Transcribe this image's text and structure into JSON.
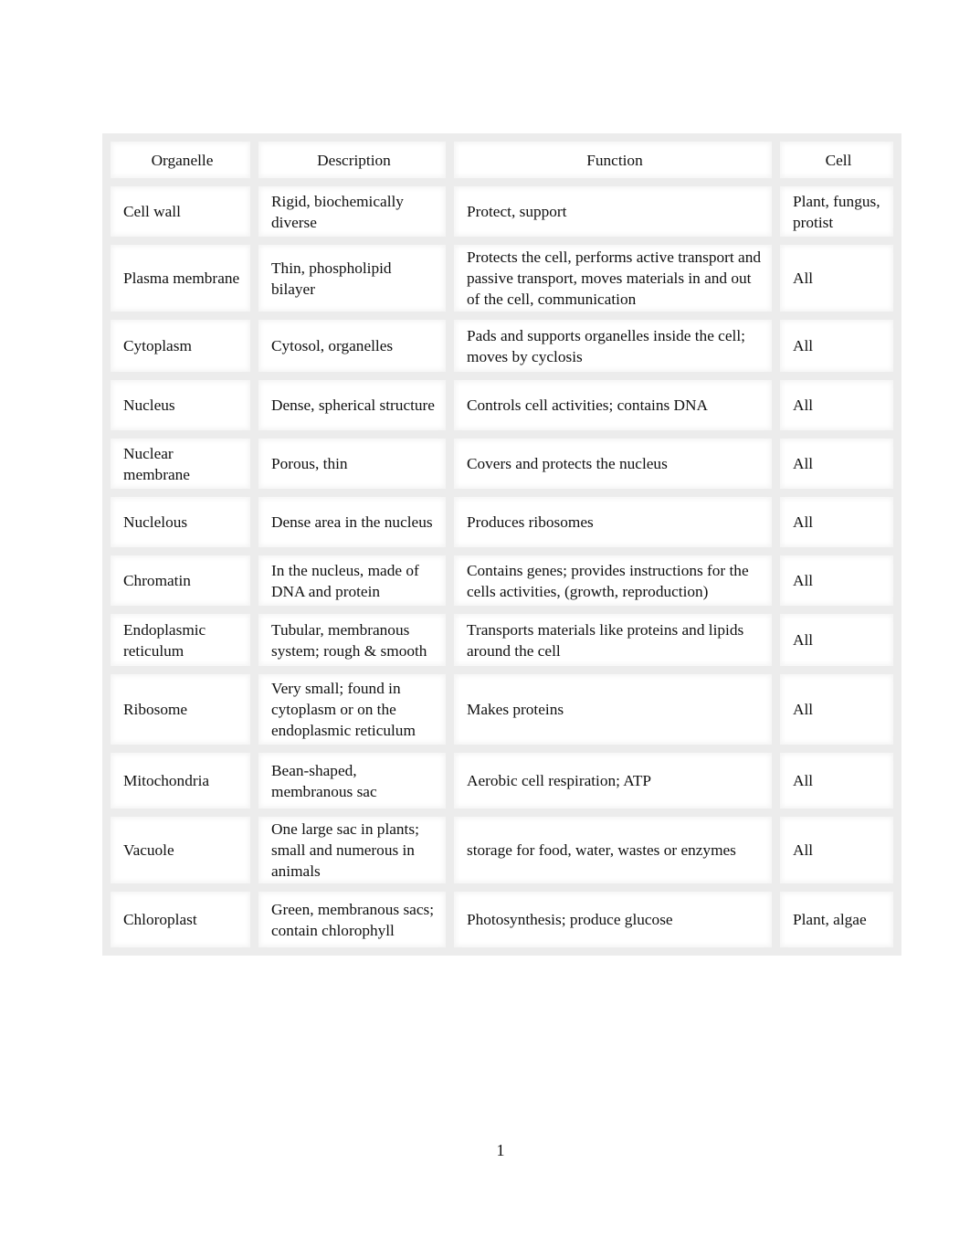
{
  "table": {
    "headers": [
      "Organelle",
      "Description",
      "Function",
      "Cell"
    ],
    "rows": [
      {
        "organelle": "Cell wall",
        "description": "Rigid, biochemically diverse",
        "function": "Protect, support",
        "cell": "Plant, fungus, protist"
      },
      {
        "organelle": "Plasma membrane",
        "description": "Thin, phospholipid bilayer",
        "function": "Protects the cell, performs active transport and passive transport, moves materials in and out of the cell, communication",
        "cell": "All"
      },
      {
        "organelle": "Cytoplasm",
        "description": "Cytosol, organelles",
        "function": "Pads and supports organelles inside the cell; moves by cyclosis",
        "cell": "All"
      },
      {
        "organelle": "Nucleus",
        "description": "Dense, spherical structure",
        "function": "Controls cell activities; contains DNA",
        "cell": "All"
      },
      {
        "organelle": "Nuclear membrane",
        "description": "Porous, thin",
        "function": "Covers and protects the nucleus",
        "cell": "All"
      },
      {
        "organelle": "Nuclelous",
        "description": "Dense area in the nucleus",
        "function": "Produces ribosomes",
        "cell": "All"
      },
      {
        "organelle": "Chromatin",
        "description": "In the nucleus, made of DNA and protein",
        "function": "Contains genes; provides instructions for the cells activities, (growth, reproduction)",
        "cell": "All"
      },
      {
        "organelle": "Endoplasmic reticulum",
        "description": "Tubular, membranous system; rough & smooth",
        "function": "Transports materials like proteins and lipids around the cell",
        "cell": "All"
      },
      {
        "organelle": "Ribosome",
        "description": "Very small; found in cytoplasm or on the endoplasmic reticulum",
        "function": "Makes proteins",
        "cell": "All"
      },
      {
        "organelle": "Mitochondria",
        "description": "Bean-shaped, membranous sac",
        "function": "Aerobic cell respiration; ATP",
        "cell": "All"
      },
      {
        "organelle": "Vacuole",
        "description": "One large sac in plants; small and numerous in animals",
        "function": "storage for food, water, wastes or enzymes",
        "cell": "All"
      },
      {
        "organelle": "Chloroplast",
        "description": "Green, membranous sacs; contain chlorophyll",
        "function": "Photosynthesis; produce glucose",
        "cell": "Plant, algae"
      }
    ]
  },
  "page_number": "1"
}
